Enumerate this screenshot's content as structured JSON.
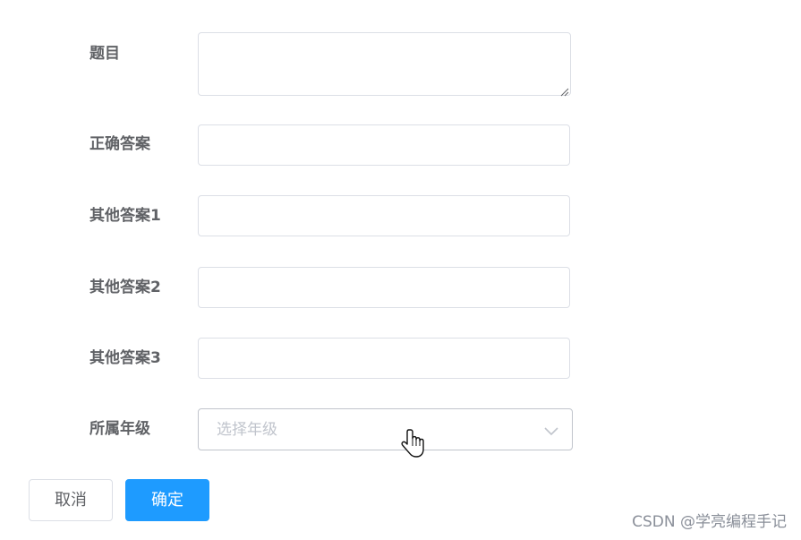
{
  "form": {
    "title_label": "题目",
    "title_value": "",
    "correct_label": "正确答案",
    "correct_value": "",
    "other1_label": "其他答案1",
    "other1_value": "",
    "other2_label": "其他答案2",
    "other2_value": "",
    "other3_label": "其他答案3",
    "other3_value": "",
    "grade_label": "所属年级",
    "grade_placeholder": "选择年级"
  },
  "buttons": {
    "cancel_label": "取消",
    "confirm_label": "确定"
  },
  "watermark": "CSDN @学亮编程手记",
  "icons": {
    "select_arrow": "chevron-down-icon",
    "cursor": "hand-pointer-icon",
    "resize": "resize-handle-icon"
  },
  "colors": {
    "primary": "#1e9bff",
    "label_text": "#606266",
    "border": "#dcdfe6",
    "placeholder": "#c0c4cc"
  }
}
